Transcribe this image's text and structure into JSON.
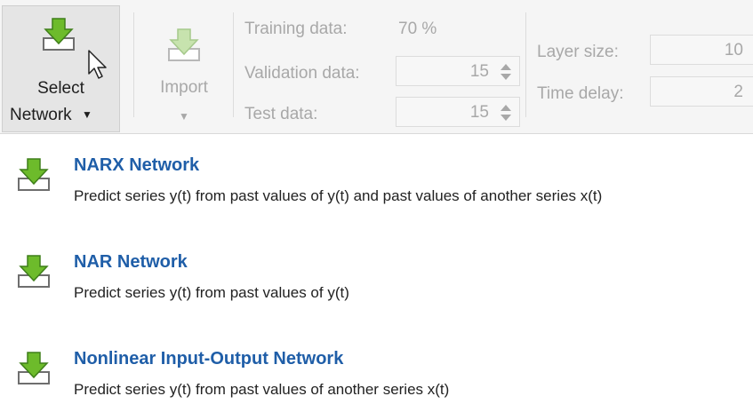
{
  "toolstrip": {
    "select_network": {
      "line1": "Select",
      "line2": "Network",
      "icon": "download-arrow-icon"
    },
    "import": {
      "label": "Import",
      "icon": "download-arrow-icon"
    },
    "training_data": {
      "label": "Training data:",
      "value": "70 %"
    },
    "validation_data": {
      "label": "Validation data:",
      "value": "15"
    },
    "test_data": {
      "label": "Test data:",
      "value": "15"
    },
    "layer_size": {
      "label": "Layer size:",
      "value": "10"
    },
    "time_delay": {
      "label": "Time delay:",
      "value": "2"
    }
  },
  "menu": {
    "items": [
      {
        "title": "NARX Network",
        "description": "Predict series y(t) from past values of y(t) and past values of another series x(t)"
      },
      {
        "title": "NAR Network",
        "description": "Predict series y(t) from past values of y(t)"
      },
      {
        "title": "Nonlinear Input-Output Network",
        "description": "Predict series y(t) from past values of another series x(t)"
      }
    ]
  },
  "colors": {
    "link_title": "#1f5ea8",
    "icon_green": "#6dbb2b",
    "disabled_text": "#a8a8a8"
  }
}
